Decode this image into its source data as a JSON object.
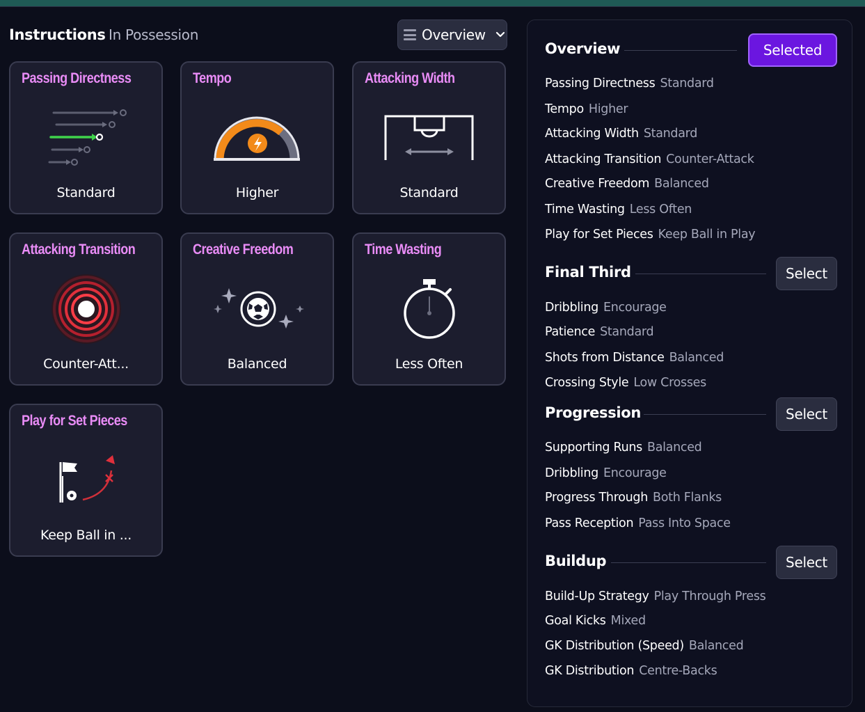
{
  "header": {
    "title": "Instructions",
    "subtitle": "In Possession",
    "view_label": "Overview"
  },
  "cards": [
    {
      "title": "Passing Directness",
      "value": "Standard"
    },
    {
      "title": "Tempo",
      "value": "Higher"
    },
    {
      "title": "Attacking Width",
      "value": "Standard"
    },
    {
      "title": "Attacking Transition",
      "value": "Counter-Att..."
    },
    {
      "title": "Creative Freedom",
      "value": "Balanced"
    },
    {
      "title": "Time Wasting",
      "value": "Less Often"
    },
    {
      "title": "Play for Set Pieces",
      "value": "Keep Ball in ..."
    }
  ],
  "panel": {
    "sections": [
      {
        "title": "Overview",
        "button": "Selected",
        "items": [
          {
            "key": "Passing Directness",
            "value": "Standard"
          },
          {
            "key": "Tempo",
            "value": "Higher"
          },
          {
            "key": "Attacking Width",
            "value": "Standard"
          },
          {
            "key": "Attacking Transition",
            "value": "Counter-Attack"
          },
          {
            "key": "Creative Freedom",
            "value": "Balanced"
          },
          {
            "key": "Time Wasting",
            "value": "Less Often"
          },
          {
            "key": "Play for Set Pieces",
            "value": "Keep Ball in Play"
          }
        ]
      },
      {
        "title": "Final Third",
        "button": "Select",
        "items": [
          {
            "key": "Dribbling",
            "value": "Encourage"
          },
          {
            "key": "Patience",
            "value": "Standard"
          },
          {
            "key": "Shots from Distance",
            "value": "Balanced"
          },
          {
            "key": "Crossing Style",
            "value": "Low Crosses"
          }
        ]
      },
      {
        "title": "Progression",
        "button": "Select",
        "items": [
          {
            "key": "Supporting Runs",
            "value": "Balanced"
          },
          {
            "key": "Dribbling",
            "value": "Encourage"
          },
          {
            "key": "Progress Through",
            "value": "Both Flanks"
          },
          {
            "key": "Pass Reception",
            "value": "Pass Into Space"
          }
        ]
      },
      {
        "title": "Buildup",
        "button": "Select",
        "items": [
          {
            "key": "Build-Up Strategy",
            "value": "Play Through Press"
          },
          {
            "key": "Goal Kicks",
            "value": "Mixed"
          },
          {
            "key": "GK Distribution (Speed)",
            "value": "Balanced"
          },
          {
            "key": "GK Distribution",
            "value": "Centre-Backs"
          }
        ]
      }
    ]
  },
  "colors": {
    "accent": "#6b16e0",
    "card_title": "#e98cf6",
    "tempo_orange": "#f28a1a",
    "transition_red": "#e0303c",
    "highlight_green": "#3fd34b"
  }
}
